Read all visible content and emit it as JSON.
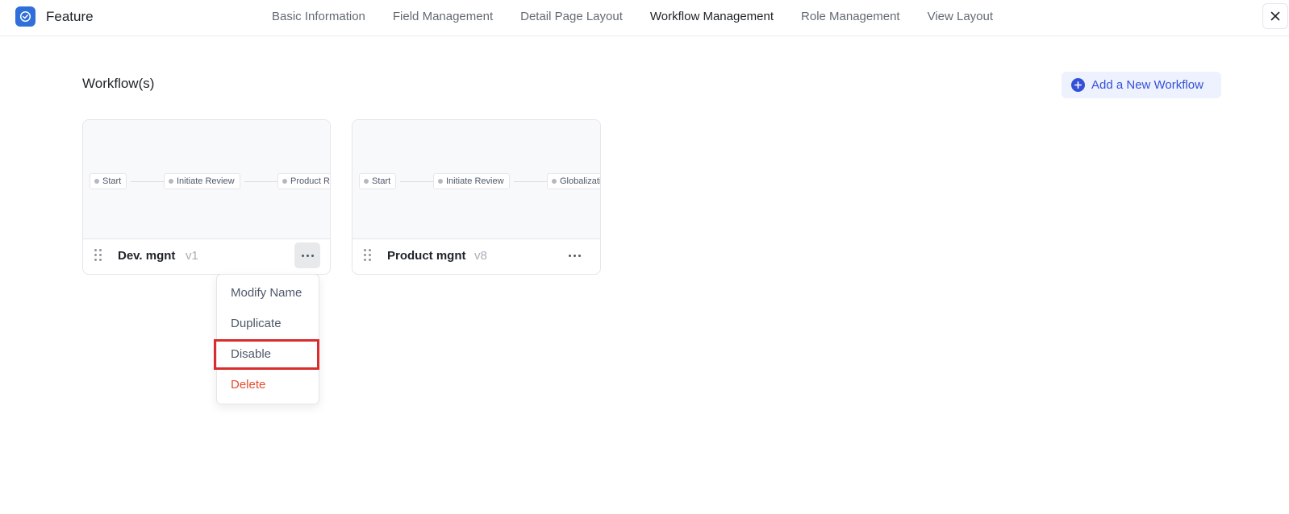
{
  "header": {
    "app_title": "Feature",
    "tabs": [
      {
        "label": "Basic Information",
        "active": false
      },
      {
        "label": "Field Management",
        "active": false
      },
      {
        "label": "Detail Page Layout",
        "active": false
      },
      {
        "label": "Workflow Management",
        "active": true
      },
      {
        "label": "Role Management",
        "active": false
      },
      {
        "label": "View Layout",
        "active": false
      }
    ]
  },
  "main": {
    "section_title": "Workflow(s)",
    "add_button_label": "Add a New Workflow",
    "cards": [
      {
        "name": "Dev. mgnt",
        "version": "v1",
        "nodes": [
          "Start",
          "Initiate Review",
          "Product Re"
        ]
      },
      {
        "name": "Product mgnt",
        "version": "v8",
        "nodes": [
          "Start",
          "Initiate Review",
          "Globalizati"
        ]
      }
    ]
  },
  "menu": {
    "items": [
      {
        "label": "Modify Name"
      },
      {
        "label": "Duplicate"
      },
      {
        "label": "Disable",
        "highlighted": true
      },
      {
        "label": "Delete",
        "danger": true
      }
    ]
  },
  "colors": {
    "accent": "#3450d6",
    "logo": "#2f6fd9",
    "danger": "#e8492e",
    "highlight": "#d92d2d"
  }
}
